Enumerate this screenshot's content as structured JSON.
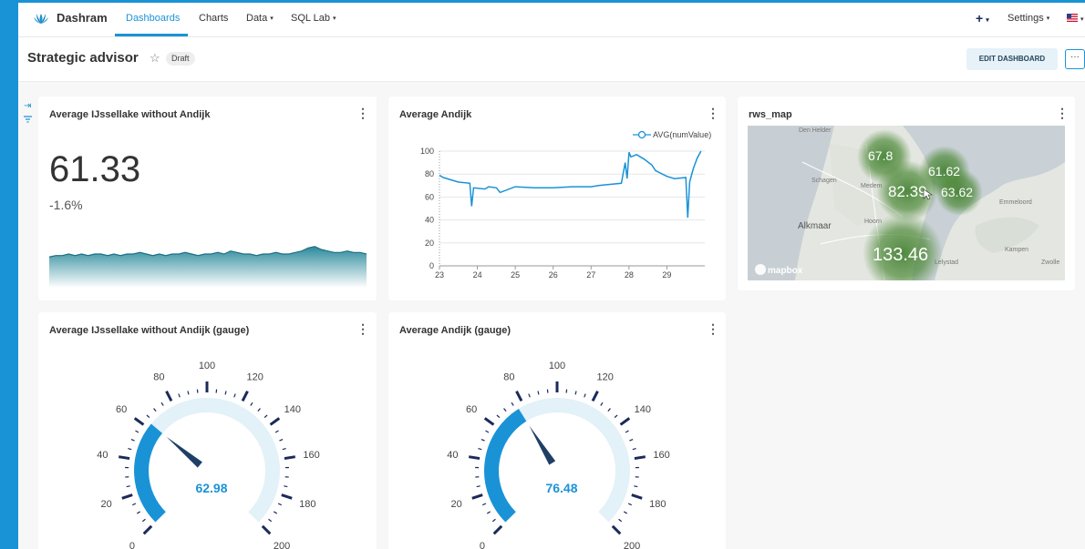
{
  "nav": {
    "brand": "Dashram",
    "items": [
      {
        "label": "Dashboards",
        "caret": ""
      },
      {
        "label": "Charts",
        "caret": ""
      },
      {
        "label": "Data",
        "caret": "▾"
      },
      {
        "label": "SQL Lab",
        "caret": "▾"
      }
    ],
    "plus": "+",
    "settings": "Settings",
    "caret": "▾"
  },
  "header": {
    "title": "Strategic advisor",
    "badge": "Draft",
    "edit_label": "EDIT DASHBOARD",
    "more_label": "···"
  },
  "cards": {
    "bignum": {
      "title": "Average IJssellake without Andijk",
      "value": "61.33",
      "delta": "-1.6%",
      "trend": [
        54,
        55,
        55,
        56,
        55,
        56,
        55,
        56,
        56,
        55,
        56,
        55,
        56,
        56,
        57,
        56,
        55,
        56,
        55,
        56,
        56,
        57,
        56,
        55,
        56,
        56,
        57,
        56,
        58,
        57,
        56,
        56,
        55,
        56,
        56,
        57,
        56,
        56,
        57,
        58,
        60,
        61,
        59,
        58,
        57,
        57,
        58,
        57,
        57,
        56
      ]
    },
    "line": {
      "title": "Average Andijk",
      "legend": "AVG(numValue)"
    },
    "map": {
      "title": "rws_map",
      "attribution": "mapbox",
      "places": [
        "Schagen",
        "Alkmaar",
        "Medem",
        "Hoorn",
        "Emmeloord",
        "Kampen",
        "Lelystad",
        "Den Helder",
        "Zwolle"
      ],
      "clusters": [
        "67.8",
        "61.62",
        "82.39",
        "63.62",
        "133.46"
      ]
    },
    "gauge1": {
      "title": "Average IJssellake without Andijk (gauge)",
      "value": "62.98"
    },
    "gauge2": {
      "title": "Average Andijk (gauge)",
      "value": "76.48"
    }
  },
  "gauge_scale": {
    "min": 0,
    "max": 200,
    "labels": [
      "0",
      "20",
      "40",
      "60",
      "80",
      "100",
      "120",
      "140",
      "160",
      "180",
      "200"
    ]
  },
  "chart_data": [
    {
      "type": "line",
      "title": "Average Andijk",
      "series": [
        {
          "name": "AVG(numValue)",
          "x": [
            23,
            23.1,
            23.3,
            23.5,
            23.8,
            23.85,
            23.9,
            24.2,
            24.3,
            24.5,
            24.6,
            25,
            25.5,
            26,
            26.5,
            27,
            27.2,
            27.5,
            27.8,
            27.9,
            27.95,
            28,
            28.05,
            28.2,
            28.4,
            28.6,
            28.7,
            29,
            29.2,
            29.5,
            29.55,
            29.6,
            29.65,
            29.7,
            29.8,
            29.9
          ],
          "y": [
            79,
            77,
            75,
            73,
            72,
            52,
            68,
            67,
            69,
            68,
            64,
            69,
            68,
            68,
            69,
            69,
            70,
            71,
            72,
            90,
            76,
            99,
            95,
            97,
            93,
            88,
            83,
            78,
            76,
            77,
            42,
            73,
            79,
            85,
            94,
            100
          ]
        }
      ],
      "xticks": [
        "23",
        "24",
        "25",
        "26",
        "27",
        "28",
        "29"
      ],
      "yticks": [
        "0",
        "20",
        "40",
        "60",
        "80",
        "100"
      ],
      "ylim": [
        0,
        100
      ],
      "xlim": [
        23,
        30
      ]
    },
    {
      "type": "gauge",
      "title": "Average IJssellake without Andijk (gauge)",
      "value": 62.98,
      "min": 0,
      "max": 200
    },
    {
      "type": "gauge",
      "title": "Average Andijk (gauge)",
      "value": 76.48,
      "min": 0,
      "max": 200
    }
  ],
  "colors": {
    "accent": "#1a93d6",
    "gauge_track": "#e3f1f8",
    "gauge_ticks": "#1b2a5a",
    "trend": "#2a8a9c",
    "map_cluster": "#4f8a3a"
  }
}
